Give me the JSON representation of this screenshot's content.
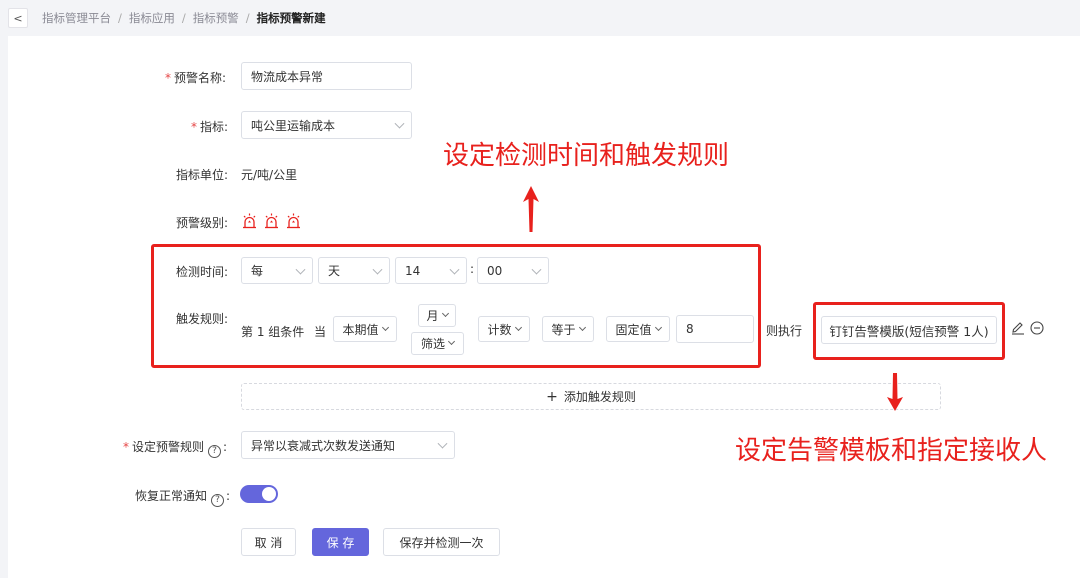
{
  "breadcrumb": {
    "items": [
      "指标管理平台",
      "指标应用",
      "指标预警"
    ],
    "current": "指标预警新建",
    "separator": "/"
  },
  "form": {
    "alert_name": {
      "label": "预警名称:",
      "value": "物流成本异常"
    },
    "metric": {
      "label": "指标:",
      "value": "吨公里运输成本"
    },
    "unit": {
      "label": "指标单位:",
      "value": "元/吨/公里"
    },
    "level": {
      "label": "预警级别:",
      "count": 3,
      "icon": "alarm-light-icon",
      "color": "#e8211d"
    },
    "detect_time": {
      "label": "检测时间:",
      "every": "每",
      "period": "天",
      "hour": "14",
      "colon": ":",
      "minute": "00"
    },
    "trigger": {
      "label": "触发规则:",
      "group_text": "第 1 组条件",
      "when": "当",
      "period_value": "本期值",
      "month": "月",
      "filter": "筛选",
      "aggregate": "计数",
      "operator": "等于",
      "compare_type": "固定值",
      "value": "8",
      "then_exec": "则执行",
      "template": "钉钉告警模版(短信预警 1人)"
    },
    "add_rule": {
      "plus": "+",
      "label": "添加触发规则"
    },
    "alert_rule": {
      "label": "设定预警规则",
      "help": "?",
      "value": "异常以衰减式次数发送通知"
    },
    "recovery": {
      "label": "恢复正常通知",
      "help": "?",
      "enabled": true
    }
  },
  "buttons": {
    "cancel": "取 消",
    "save": "保 存",
    "save_detect": "保存并检测一次"
  },
  "annotations": {
    "top": "设定检测时间和触发规则",
    "bottom": "设定告警模板和指定接收人",
    "color": "#e8211d"
  },
  "colors": {
    "primary": "#6466dc",
    "required": "#e54545"
  }
}
